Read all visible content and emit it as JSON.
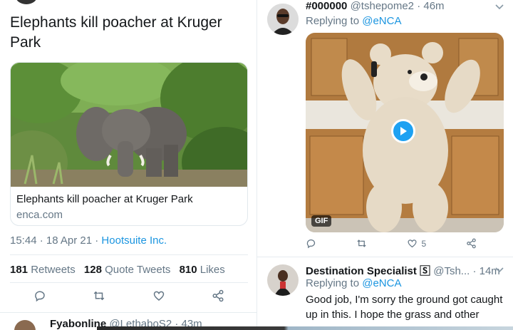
{
  "left": {
    "headline": "Elephants kill poacher at Kruger Park",
    "card": {
      "title": "Elephants kill poacher at Kruger Park",
      "domain": "enca.com"
    },
    "meta": {
      "time": "15:44 · 18 Apr 21 · ",
      "source": "Hootsuite Inc."
    },
    "stats": {
      "retweets_count": "181",
      "retweets_label": " Retweets",
      "quotes_count": "128",
      "quotes_label": " Quote Tweets",
      "likes_count": "810",
      "likes_label": " Likes"
    },
    "next_tweet": {
      "name": "Fyabonline",
      "handle": "@LethaboS2 · 43m"
    }
  },
  "right": {
    "tweet1": {
      "name": "#000000",
      "handle": "@tshepome2 · 46m",
      "replying_prefix": "Replying to ",
      "mention": "@eNCA",
      "gif_label": "GIF",
      "like_count": "5"
    },
    "tweet2": {
      "name": "Destination Specialist 🅂",
      "handle": "@Tsh... · 14m",
      "replying_prefix": "Replying to ",
      "mention": "@eNCA",
      "body": "Good job, I'm sorry the ground got caught up in this. I hope the grass and other"
    }
  },
  "colors": {
    "link": "#1b95e0",
    "secondary_text": "#657786",
    "divider": "#e6ecf0",
    "play_button": "#1da1f2"
  },
  "icons": [
    "reply-icon",
    "retweet-icon",
    "like-icon",
    "share-icon",
    "chevron-down-icon",
    "play-icon"
  ]
}
